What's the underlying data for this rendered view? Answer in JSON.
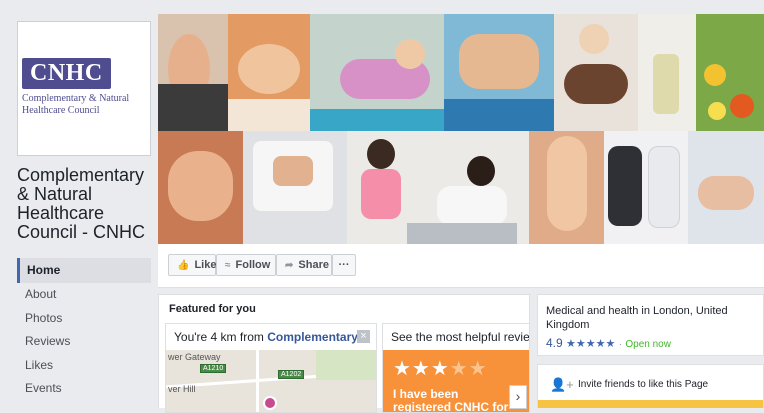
{
  "sidebar": {
    "logo": {
      "abbr": "CNHC",
      "line1": "Complementary & Natural",
      "line2": "Healthcare Council"
    },
    "page_name": "Complementary & Natural Healthcare Council - CNHC",
    "nav": [
      {
        "label": "Home",
        "active": true
      },
      {
        "label": "About"
      },
      {
        "label": "Photos"
      },
      {
        "label": "Reviews"
      },
      {
        "label": "Likes"
      },
      {
        "label": "Events"
      }
    ]
  },
  "actions": {
    "like": "Like",
    "follow": "Follow",
    "share": "Share",
    "more": "···"
  },
  "featured": {
    "title": "Featured for you",
    "map_card": {
      "prefix": "You're 4 km from ",
      "place": "Complementary...",
      "close": "×",
      "labels": [
        "wer Gateway",
        "ver Hill"
      ],
      "roads": [
        "A1210",
        "A1202"
      ]
    },
    "review_card": {
      "title": "See the most helpful reviews o",
      "stars_on": "★★★",
      "stars_off": "★★",
      "text": "I have been registered CNHC for a years but I",
      "next": "›"
    }
  },
  "info": {
    "category": "Medical and health in London, United Kingdom",
    "rating": "4.9",
    "stars": "★★★★★",
    "dot": "·",
    "status": "Open now"
  },
  "invite": {
    "text": "Invite friends to like this Page"
  },
  "colors": {
    "brand_purple": "#4f4c8f",
    "fb_blue": "#4267b2",
    "link_blue": "#365899",
    "open_green": "#42b72a",
    "review_orange": "#f7923a"
  }
}
